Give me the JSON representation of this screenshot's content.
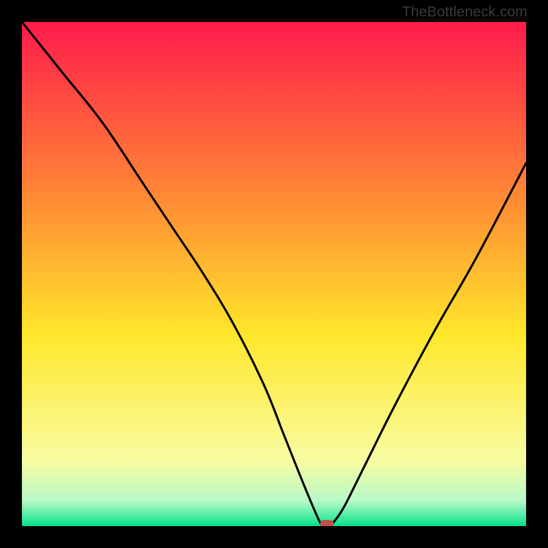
{
  "header": {
    "watermark": "TheBottleneck.com"
  },
  "colors": {
    "background": "#000000",
    "curve": "#000000",
    "marker": "#c05050",
    "gradient_top": "#ff1b4b",
    "gradient_mid_upper": "#ff8a34",
    "gradient_mid": "#ffe72b",
    "gradient_mid_lower": "#f8fca1",
    "gradient_near_bottom": "#b8f9c8",
    "gradient_bottom": "#06e18a"
  },
  "chart_data": {
    "type": "line",
    "title": "",
    "xlabel": "",
    "ylabel": "",
    "xlim": [
      0,
      100
    ],
    "ylim": [
      0,
      100
    ],
    "grid": false,
    "legend": false,
    "x": [
      0,
      8,
      16,
      24,
      30,
      36,
      42,
      48,
      52,
      56,
      59,
      60,
      61,
      62,
      64,
      68,
      74,
      82,
      90,
      100
    ],
    "values": [
      100,
      90,
      80,
      68,
      59,
      50,
      40,
      28,
      18,
      8,
      1,
      0,
      0,
      1,
      4,
      12,
      24,
      39,
      53,
      72
    ],
    "annotations": [
      {
        "type": "marker",
        "x": 60.5,
        "y": 0
      }
    ]
  }
}
